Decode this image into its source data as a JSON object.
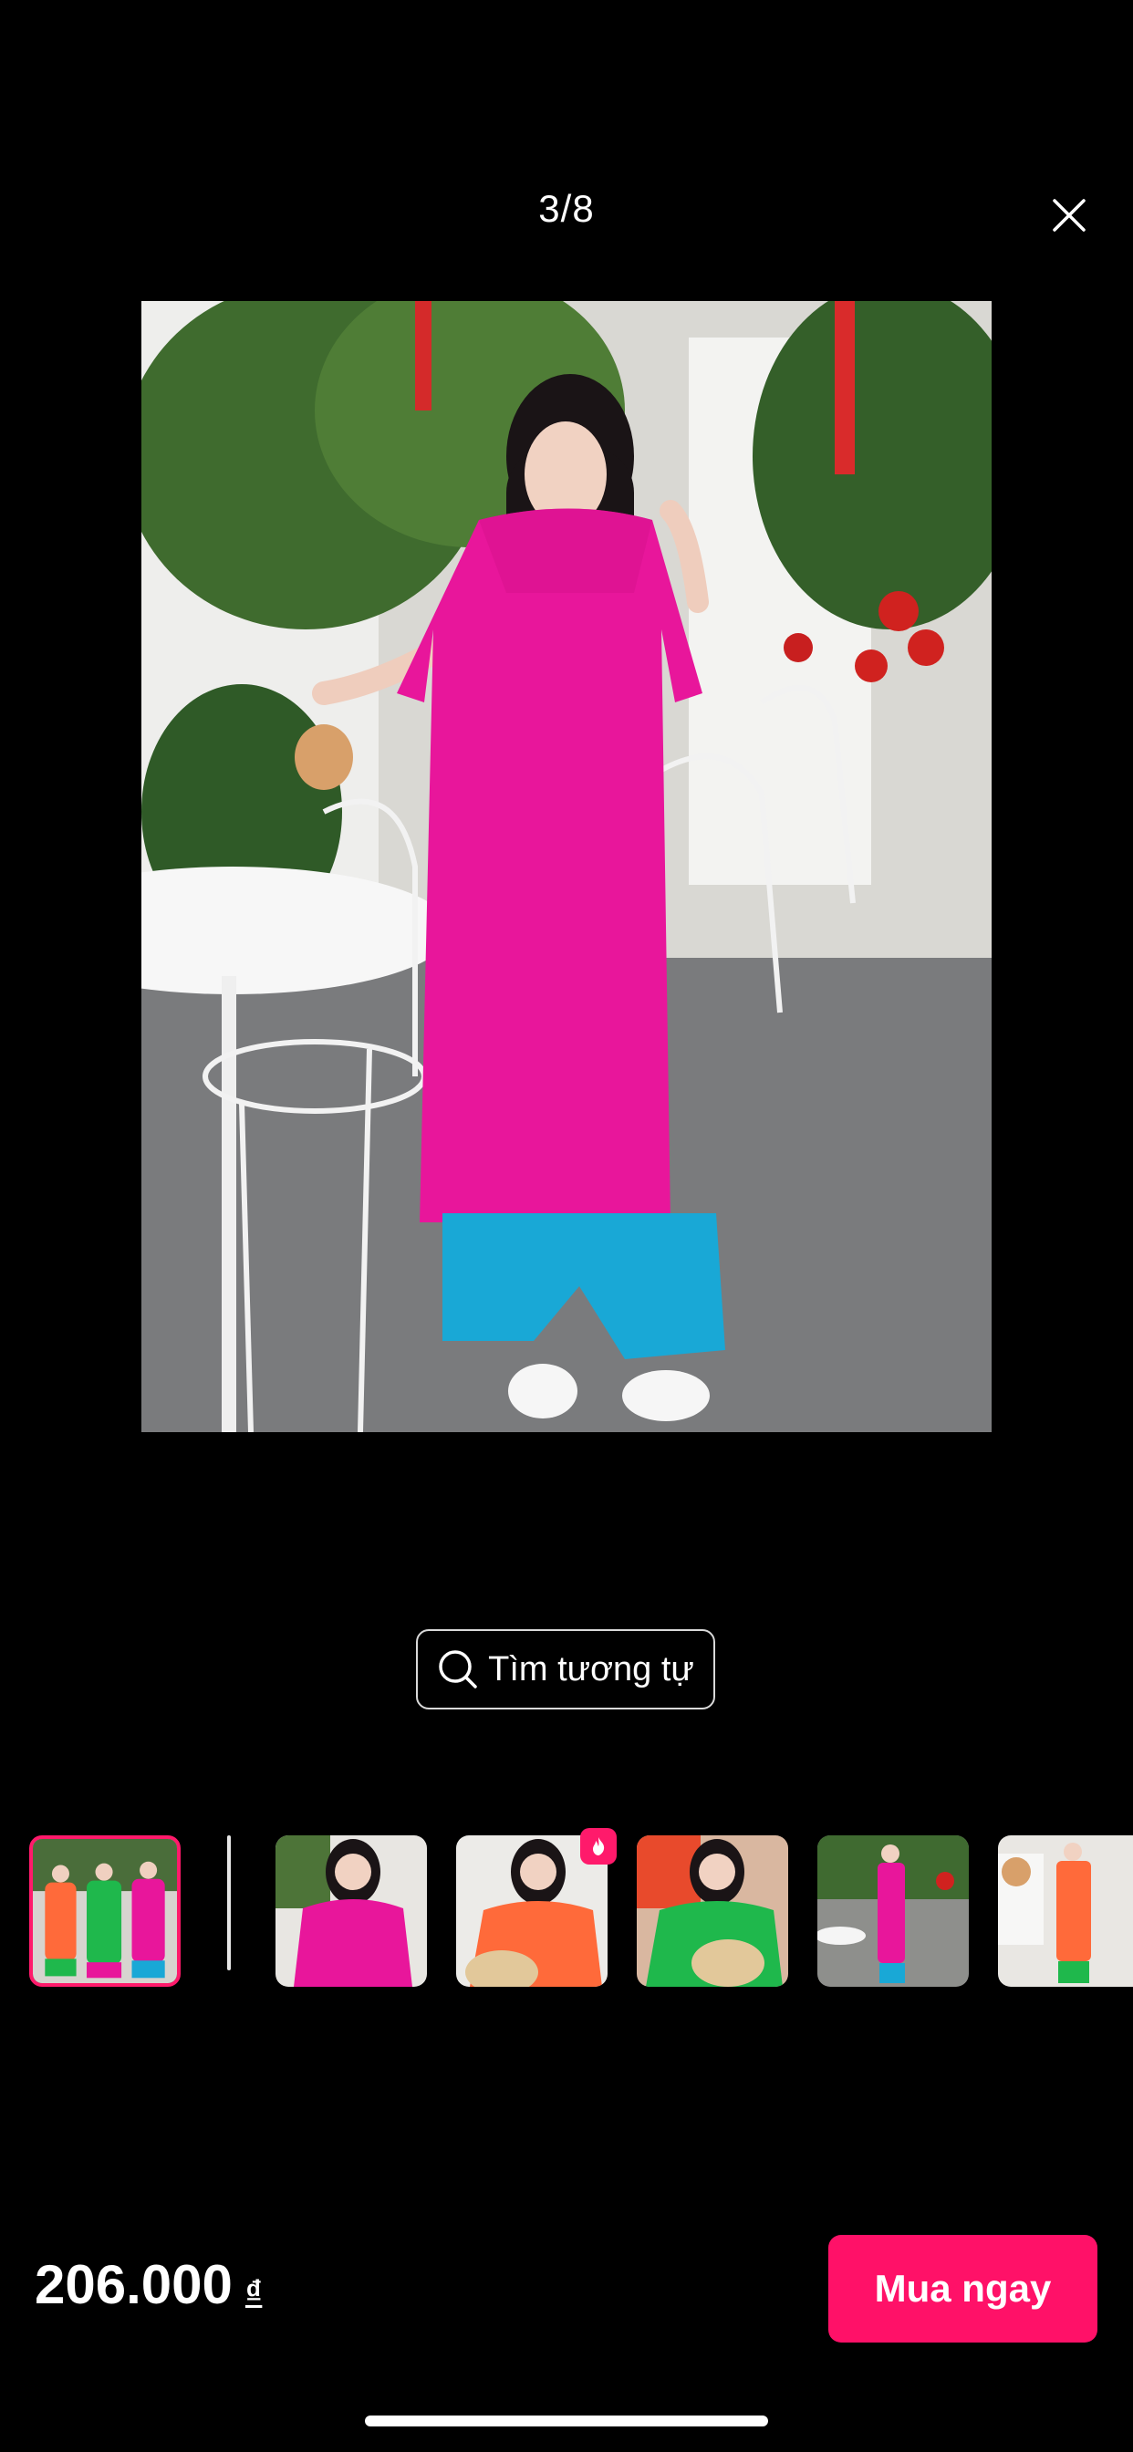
{
  "viewer": {
    "counter": "3/8",
    "close_icon": "close-icon"
  },
  "search_similar": {
    "icon": "search-icon",
    "label": "Tìm tương tự"
  },
  "thumbnails": [
    {
      "dress_color": "#ff6a3a",
      "label": "group"
    },
    {
      "dress_color": "#e8169b",
      "label": "pink"
    },
    {
      "dress_color": "#ff6a3a",
      "label": "orange",
      "badge": "hot-icon"
    },
    {
      "dress_color": "#1fb84c",
      "label": "green"
    },
    {
      "dress_color": "#e8169b",
      "label": "pink-full"
    },
    {
      "dress_color": "#ff6a3a",
      "label": "orange-full"
    }
  ],
  "price": {
    "amount": "206.000",
    "currency": "₫"
  },
  "buy_button": {
    "label": "Mua ngay",
    "color": "#ff1168"
  },
  "colors": {
    "accent": "#ff1a6b",
    "background": "#000000"
  }
}
